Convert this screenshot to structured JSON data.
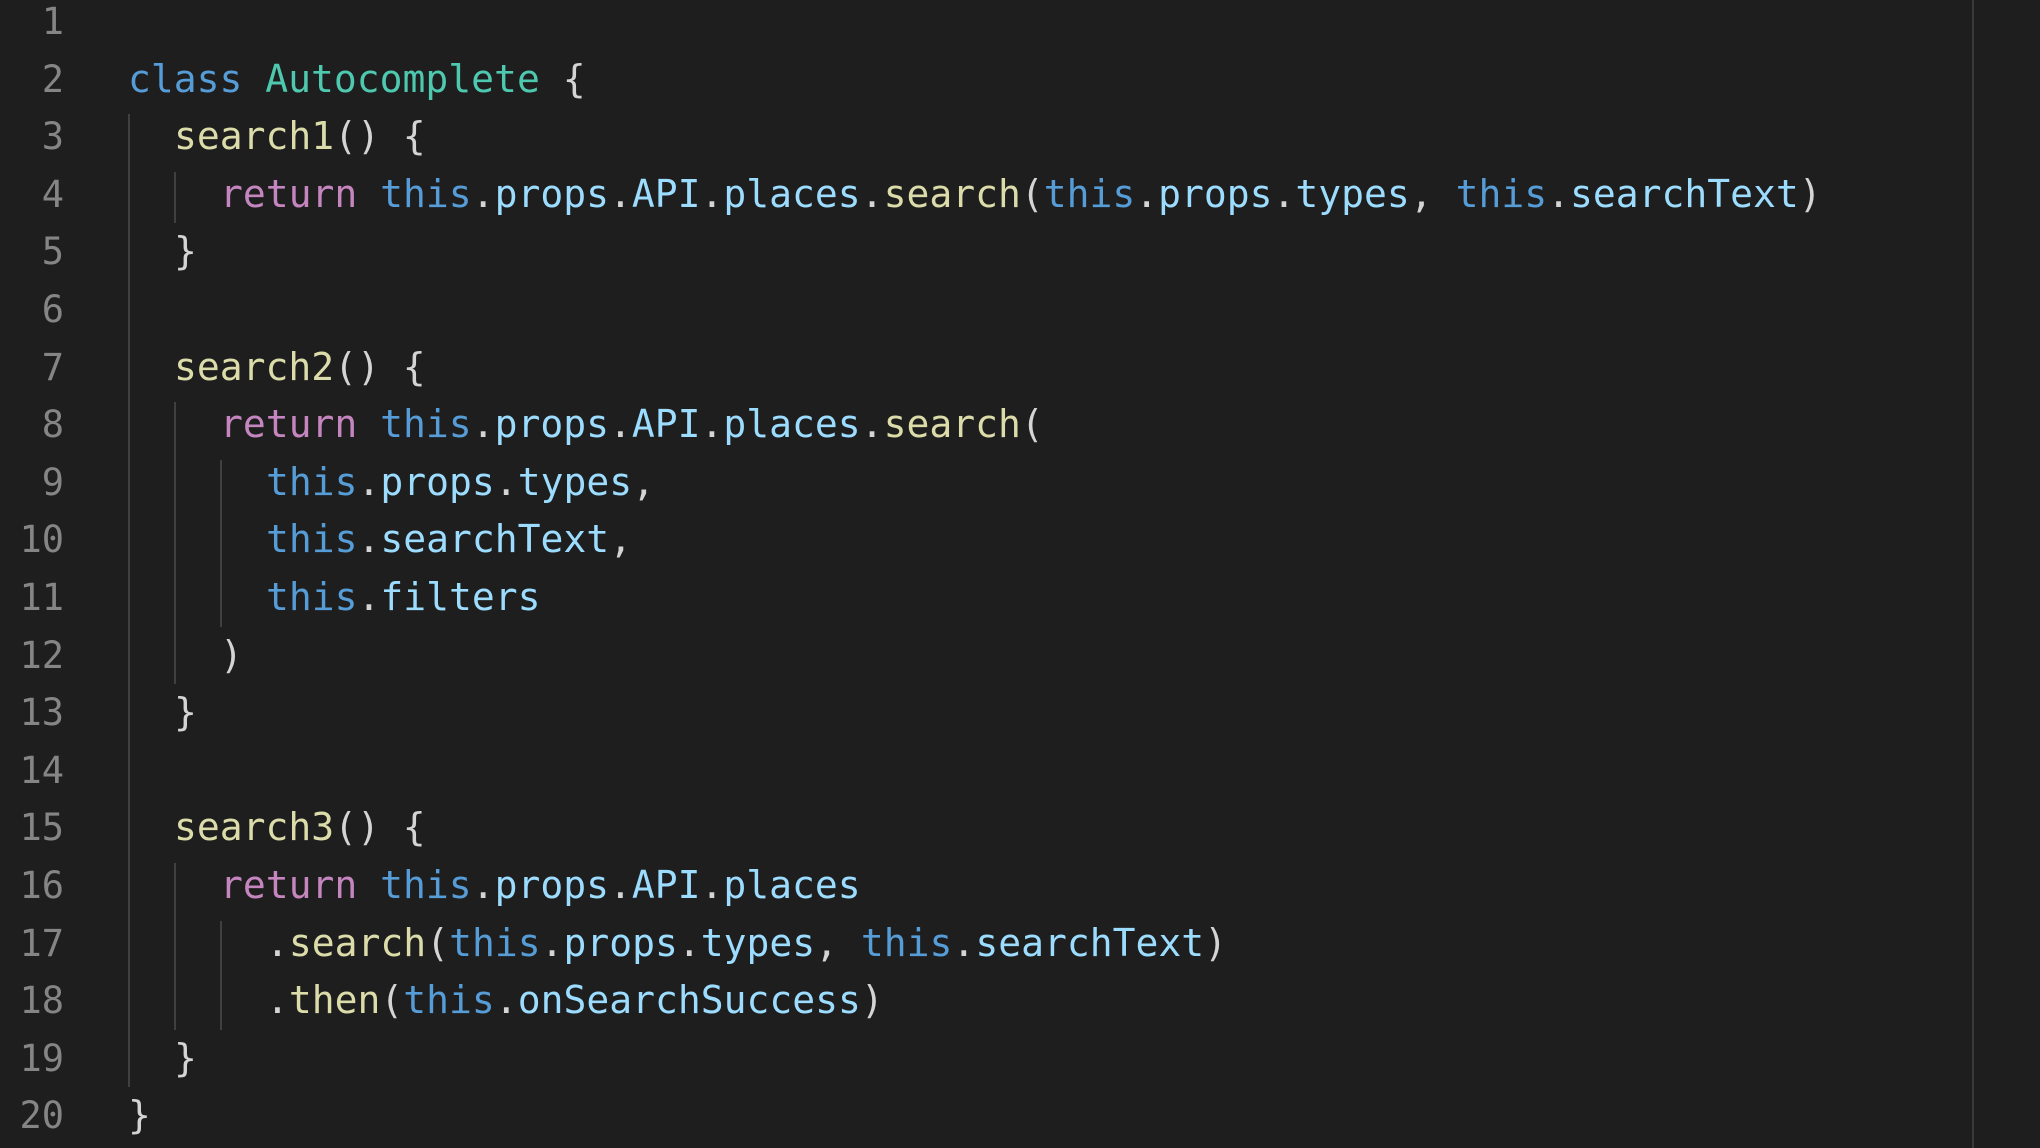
{
  "lines": [
    {
      "num": "1",
      "indent": 0,
      "tokens": []
    },
    {
      "num": "2",
      "indent": 0,
      "tokens": [
        {
          "t": "class",
          "c": "kw"
        },
        {
          "t": " ",
          "c": "punc"
        },
        {
          "t": "Autocomplete",
          "c": "cls"
        },
        {
          "t": " {",
          "c": "punc"
        }
      ]
    },
    {
      "num": "3",
      "indent": 1,
      "tokens": [
        {
          "t": "search1",
          "c": "fn"
        },
        {
          "t": "() {",
          "c": "punc"
        }
      ]
    },
    {
      "num": "4",
      "indent": 2,
      "tokens": [
        {
          "t": "return",
          "c": "ret"
        },
        {
          "t": " ",
          "c": "punc"
        },
        {
          "t": "this",
          "c": "this"
        },
        {
          "t": ".",
          "c": "punc"
        },
        {
          "t": "props",
          "c": "prop"
        },
        {
          "t": ".",
          "c": "punc"
        },
        {
          "t": "API",
          "c": "prop"
        },
        {
          "t": ".",
          "c": "punc"
        },
        {
          "t": "places",
          "c": "prop"
        },
        {
          "t": ".",
          "c": "punc"
        },
        {
          "t": "search",
          "c": "fn"
        },
        {
          "t": "(",
          "c": "punc"
        },
        {
          "t": "this",
          "c": "this"
        },
        {
          "t": ".",
          "c": "punc"
        },
        {
          "t": "props",
          "c": "prop"
        },
        {
          "t": ".",
          "c": "punc"
        },
        {
          "t": "types",
          "c": "prop"
        },
        {
          "t": ", ",
          "c": "punc"
        },
        {
          "t": "this",
          "c": "this"
        },
        {
          "t": ".",
          "c": "punc"
        },
        {
          "t": "searchText",
          "c": "prop"
        },
        {
          "t": ")",
          "c": "punc"
        }
      ]
    },
    {
      "num": "5",
      "indent": 1,
      "tokens": [
        {
          "t": "}",
          "c": "punc"
        }
      ]
    },
    {
      "num": "6",
      "indent": 0,
      "tokens": []
    },
    {
      "num": "7",
      "indent": 1,
      "tokens": [
        {
          "t": "search2",
          "c": "fn"
        },
        {
          "t": "() {",
          "c": "punc"
        }
      ]
    },
    {
      "num": "8",
      "indent": 2,
      "tokens": [
        {
          "t": "return",
          "c": "ret"
        },
        {
          "t": " ",
          "c": "punc"
        },
        {
          "t": "this",
          "c": "this"
        },
        {
          "t": ".",
          "c": "punc"
        },
        {
          "t": "props",
          "c": "prop"
        },
        {
          "t": ".",
          "c": "punc"
        },
        {
          "t": "API",
          "c": "prop"
        },
        {
          "t": ".",
          "c": "punc"
        },
        {
          "t": "places",
          "c": "prop"
        },
        {
          "t": ".",
          "c": "punc"
        },
        {
          "t": "search",
          "c": "fn"
        },
        {
          "t": "(",
          "c": "punc"
        }
      ]
    },
    {
      "num": "9",
      "indent": 3,
      "tokens": [
        {
          "t": "this",
          "c": "this"
        },
        {
          "t": ".",
          "c": "punc"
        },
        {
          "t": "props",
          "c": "prop"
        },
        {
          "t": ".",
          "c": "punc"
        },
        {
          "t": "types",
          "c": "prop"
        },
        {
          "t": ",",
          "c": "punc"
        }
      ]
    },
    {
      "num": "10",
      "indent": 3,
      "tokens": [
        {
          "t": "this",
          "c": "this"
        },
        {
          "t": ".",
          "c": "punc"
        },
        {
          "t": "searchText",
          "c": "prop"
        },
        {
          "t": ",",
          "c": "punc"
        }
      ]
    },
    {
      "num": "11",
      "indent": 3,
      "tokens": [
        {
          "t": "this",
          "c": "this"
        },
        {
          "t": ".",
          "c": "punc"
        },
        {
          "t": "filters",
          "c": "prop"
        }
      ]
    },
    {
      "num": "12",
      "indent": 2,
      "tokens": [
        {
          "t": ")",
          "c": "punc"
        }
      ]
    },
    {
      "num": "13",
      "indent": 1,
      "tokens": [
        {
          "t": "}",
          "c": "punc"
        }
      ]
    },
    {
      "num": "14",
      "indent": 0,
      "tokens": []
    },
    {
      "num": "15",
      "indent": 1,
      "tokens": [
        {
          "t": "search3",
          "c": "fn"
        },
        {
          "t": "() {",
          "c": "punc"
        }
      ]
    },
    {
      "num": "16",
      "indent": 2,
      "tokens": [
        {
          "t": "return",
          "c": "ret"
        },
        {
          "t": " ",
          "c": "punc"
        },
        {
          "t": "this",
          "c": "this"
        },
        {
          "t": ".",
          "c": "punc"
        },
        {
          "t": "props",
          "c": "prop"
        },
        {
          "t": ".",
          "c": "punc"
        },
        {
          "t": "API",
          "c": "prop"
        },
        {
          "t": ".",
          "c": "punc"
        },
        {
          "t": "places",
          "c": "prop"
        }
      ]
    },
    {
      "num": "17",
      "indent": 3,
      "tokens": [
        {
          "t": ".",
          "c": "punc"
        },
        {
          "t": "search",
          "c": "fn"
        },
        {
          "t": "(",
          "c": "punc"
        },
        {
          "t": "this",
          "c": "this"
        },
        {
          "t": ".",
          "c": "punc"
        },
        {
          "t": "props",
          "c": "prop"
        },
        {
          "t": ".",
          "c": "punc"
        },
        {
          "t": "types",
          "c": "prop"
        },
        {
          "t": ", ",
          "c": "punc"
        },
        {
          "t": "this",
          "c": "this"
        },
        {
          "t": ".",
          "c": "punc"
        },
        {
          "t": "searchText",
          "c": "prop"
        },
        {
          "t": ")",
          "c": "punc"
        }
      ]
    },
    {
      "num": "18",
      "indent": 3,
      "tokens": [
        {
          "t": ".",
          "c": "punc"
        },
        {
          "t": "then",
          "c": "fn"
        },
        {
          "t": "(",
          "c": "punc"
        },
        {
          "t": "this",
          "c": "this"
        },
        {
          "t": ".",
          "c": "punc"
        },
        {
          "t": "onSearchSuccess",
          "c": "prop"
        },
        {
          "t": ")",
          "c": "punc"
        }
      ]
    },
    {
      "num": "19",
      "indent": 1,
      "tokens": [
        {
          "t": "}",
          "c": "punc"
        }
      ]
    },
    {
      "num": "20",
      "indent": 0,
      "tokens": [
        {
          "t": "}",
          "c": "punc"
        }
      ]
    }
  ],
  "theme": {
    "background": "#1e1e1e",
    "keyword": "#569cd6",
    "return_keyword": "#c586c0",
    "class_name": "#4ec9b0",
    "function": "#dcdcaa",
    "property": "#9cdcfe",
    "punctuation": "#d4d4d4",
    "line_number": "#858585"
  }
}
